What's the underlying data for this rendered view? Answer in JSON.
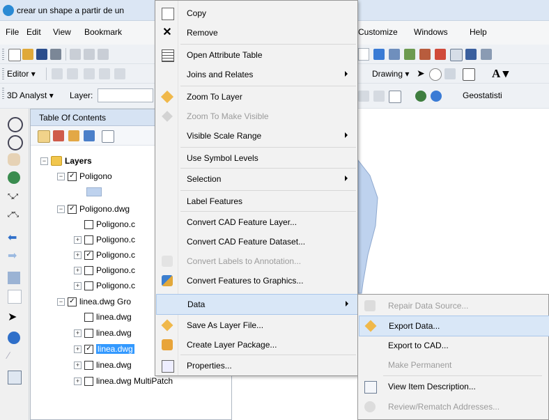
{
  "window": {
    "title": "crear un shape a partir de un"
  },
  "menubar": {
    "items": [
      "File",
      "Edit",
      "View",
      "Bookmark",
      "Customize",
      "Windows",
      "Help"
    ]
  },
  "toolbars": {
    "editor_label": "Editor",
    "drawing_label": "Drawing",
    "analyst_label": "3D Analyst",
    "layer_label": "Layer:",
    "geostat_label": "Geostatisti"
  },
  "toc": {
    "title": "Table Of Contents",
    "layers_root": "Layers",
    "rows": [
      {
        "label": "Poligono",
        "checked": true
      },
      {
        "label": "Poligono.dwg",
        "checked": true
      },
      {
        "label": "Poligono.c",
        "checked": false
      },
      {
        "label": "Poligono.c",
        "checked": false
      },
      {
        "label": "Poligono.c",
        "checked": true
      },
      {
        "label": "Poligono.c",
        "checked": false
      },
      {
        "label": "Poligono.c",
        "checked": false
      },
      {
        "label": "linea.dwg Gro",
        "checked": true
      },
      {
        "label": "linea.dwg",
        "checked": false
      },
      {
        "label": "linea.dwg",
        "checked": false
      },
      {
        "label": "linea.dwg",
        "checked": true
      },
      {
        "label": "linea.dwg",
        "checked": false
      },
      {
        "label": "linea.dwg MultiPatch",
        "checked": false
      }
    ]
  },
  "context_menu": {
    "items": [
      {
        "label": "Copy",
        "icon": "copy-icon",
        "enabled": true
      },
      {
        "label": "Remove",
        "icon": "remove-icon",
        "enabled": true
      },
      {
        "label": "Open Attribute Table",
        "icon": "table-icon",
        "enabled": true
      },
      {
        "label": "Joins and Relates",
        "enabled": true,
        "submenu": true
      },
      {
        "label": "Zoom To Layer",
        "icon": "zoom-layer-icon",
        "enabled": true
      },
      {
        "label": "Zoom To Make Visible",
        "icon": "zoom-visible-icon",
        "enabled": false
      },
      {
        "label": "Visible Scale Range",
        "enabled": true,
        "submenu": true
      },
      {
        "label": "Use Symbol Levels",
        "enabled": true
      },
      {
        "label": "Selection",
        "enabled": true,
        "submenu": true
      },
      {
        "label": "Label Features",
        "enabled": true
      },
      {
        "label": "Convert CAD Feature Layer...",
        "enabled": true
      },
      {
        "label": "Convert CAD Feature Dataset...",
        "enabled": true
      },
      {
        "label": "Convert Labels to Annotation...",
        "icon": "annotation-icon",
        "enabled": false
      },
      {
        "label": "Convert Features to Graphics...",
        "icon": "graphics-icon",
        "enabled": true
      },
      {
        "label": "Data",
        "enabled": true,
        "submenu": true,
        "highlighted": true
      },
      {
        "label": "Save As Layer File...",
        "icon": "layer-file-icon",
        "enabled": true
      },
      {
        "label": "Create Layer Package...",
        "icon": "layer-package-icon",
        "enabled": true
      },
      {
        "label": "Properties...",
        "icon": "properties-icon",
        "enabled": true
      }
    ]
  },
  "data_submenu": {
    "items": [
      {
        "label": "Repair Data Source...",
        "enabled": false
      },
      {
        "label": "Export Data...",
        "enabled": true,
        "highlighted": true
      },
      {
        "label": "Export to CAD...",
        "enabled": true
      },
      {
        "label": "Make Permanent",
        "enabled": false
      },
      {
        "label": "View Item Description...",
        "enabled": true
      },
      {
        "label": "Review/Rematch Addresses...",
        "enabled": false
      }
    ]
  },
  "colors": {
    "highlight": "#d9e7f7",
    "map_polygon": "#bed2ee"
  }
}
